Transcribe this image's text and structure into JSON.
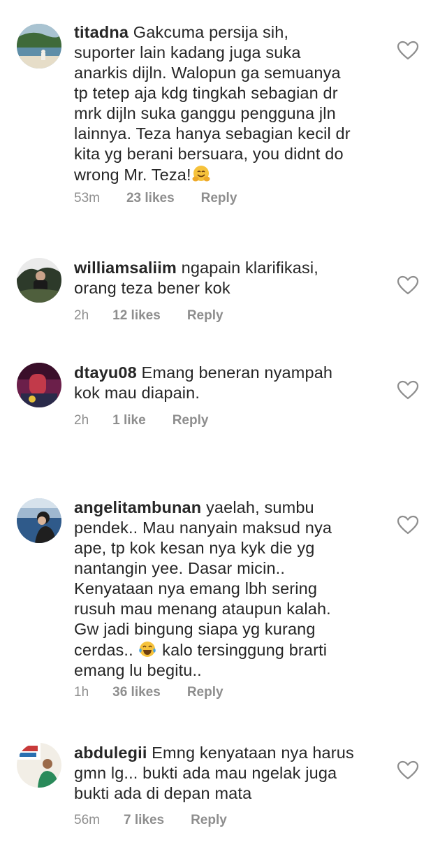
{
  "comments": [
    {
      "username": "titadna",
      "text": " Gakcuma persija sih,\nsuporter lain kadang juga suka\nanarkis dijln. Walopun ga semuanya\ntp tetep aja kdg tingkah sebagian dr\nmrk dijln suka ganggu pengguna jln\nlainnya. Teza hanya sebagian kecil dr\nkita yg berani bersuara, you didnt do\nwrong Mr. Teza!",
      "emoji": "hugging-face",
      "time": "53m",
      "likes": "23 likes",
      "reply": "Reply"
    },
    {
      "username": "williamsaliim",
      "text": " ngapain klarifikasi,\norang teza bener kok",
      "time": "2h",
      "likes": "12 likes",
      "reply": "Reply"
    },
    {
      "username": "dtayu08",
      "text": " Emang beneran nyampah\nkok mau diapain.",
      "time": "2h",
      "likes": "1 like",
      "reply": "Reply"
    },
    {
      "username": "angelitambunan",
      "text": " yaelah, sumbu\npendek.. Mau nanyain maksud nya\nape, tp kok kesan nya kyk die yg\nnantangin yee. Dasar micin..\nKenyataan nya emang lbh sering\nrusuh mau menang ataupun kalah.\nGw jadi bingung siapa yg kurang\ncerdas..",
      "emoji": "tears-of-joy",
      "text_after": " kalo tersinggung brarti\nemang lu begitu..",
      "time": "1h",
      "likes": "36 likes",
      "reply": "Reply"
    },
    {
      "username": "abdulegii",
      "text": " Emng kenyataan nya harus\ngmn lg... bukti ada mau ngelak juga\nbukti ada di depan mata",
      "time": "56m",
      "likes": "7 likes",
      "reply": "Reply"
    }
  ],
  "colors": {
    "text": "#262626",
    "meta": "#8e8e8e",
    "heart": "#8e8e8e"
  }
}
